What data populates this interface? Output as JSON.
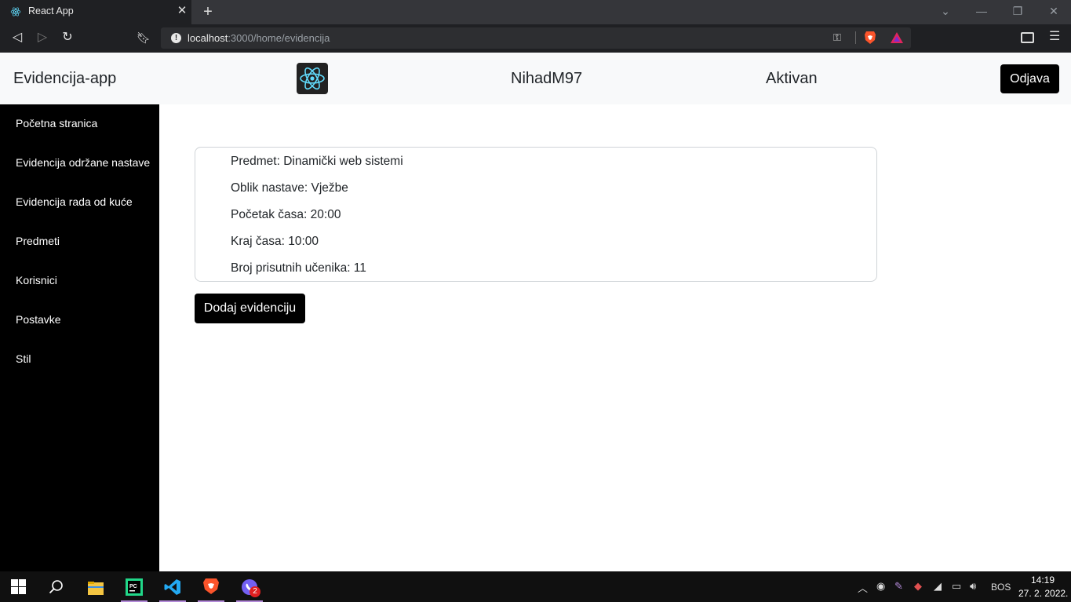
{
  "browser": {
    "tab_title": "React App",
    "url_host": "localhost",
    "url_path": ":3000/home/evidencija"
  },
  "header": {
    "brand": "Evidencija-app",
    "username": "NihadM97",
    "status": "Aktivan",
    "logout_label": "Odjava"
  },
  "sidebar": {
    "items": [
      {
        "label": "Početna stranica"
      },
      {
        "label": "Evidencija održane nastave"
      },
      {
        "label": "Evidencija rada od kuće"
      },
      {
        "label": "Predmeti"
      },
      {
        "label": "Korisnici"
      },
      {
        "label": "Postavke"
      },
      {
        "label": "Stil"
      }
    ]
  },
  "record": {
    "subject": "Predmet: Dinamički web sistemi",
    "type": "Oblik nastave: Vježbe",
    "start": "Početak časa: 20:00",
    "end": "Kraj časa: 10:00",
    "students": "Broj prisutnih učenika: 11"
  },
  "main": {
    "add_label": "Dodaj evidenciju"
  },
  "taskbar": {
    "time": "14:19",
    "date": "27. 2. 2022.",
    "lang": "BOS",
    "badge": "2"
  },
  "colors": {
    "accent": "#000000",
    "react": "#61dafb"
  }
}
